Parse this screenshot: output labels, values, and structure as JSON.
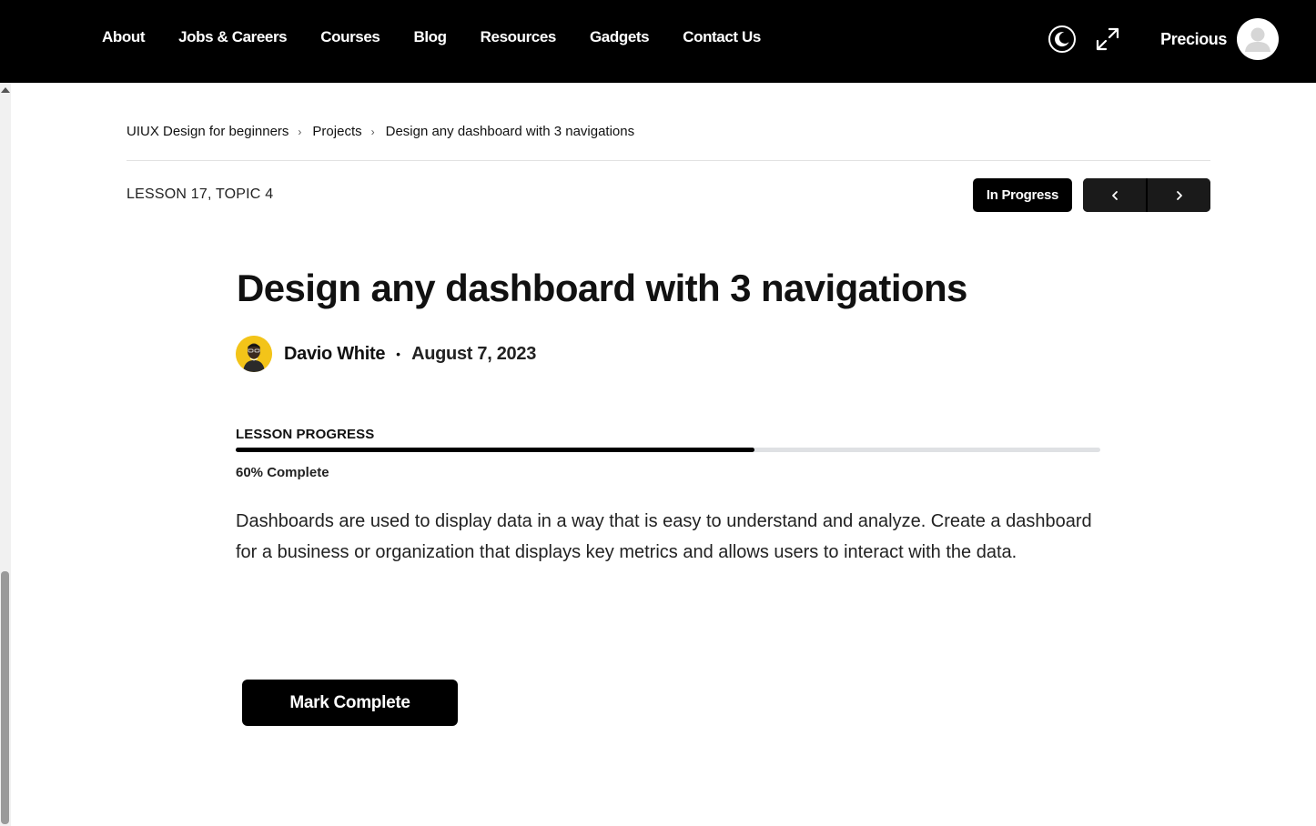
{
  "nav": {
    "items": [
      "About",
      "Jobs & Careers",
      "Courses",
      "Blog",
      "Resources",
      "Gadgets",
      "Contact Us"
    ]
  },
  "header": {
    "user_name": "Precious",
    "icons": [
      "moon-icon",
      "expand-icon",
      "user-avatar-icon"
    ]
  },
  "breadcrumb": [
    "UIUX Design for beginners",
    "Projects",
    "Design any dashboard with 3 navigations"
  ],
  "lesson": {
    "meta": "LESSON 17, TOPIC 4",
    "status": "In Progress",
    "title": "Design any dashboard with 3 navigations",
    "author": "Davio White",
    "separator": "•",
    "date": "August 7, 2023",
    "progress_label": "LESSON PROGRESS",
    "progress_percent": 60,
    "progress_text": "60% Complete",
    "description": "Dashboards are used to display data in a way that is easy to understand and analyze. Create a dashboard for a business or organization that displays key metrics and allows users to interact with the data.",
    "mark_complete_label": "Mark Complete"
  },
  "colors": {
    "header_bg": "#000000",
    "accent": "#000000",
    "progress_track": "#dfe1e4",
    "author_avatar_bg": "#f3c419"
  }
}
